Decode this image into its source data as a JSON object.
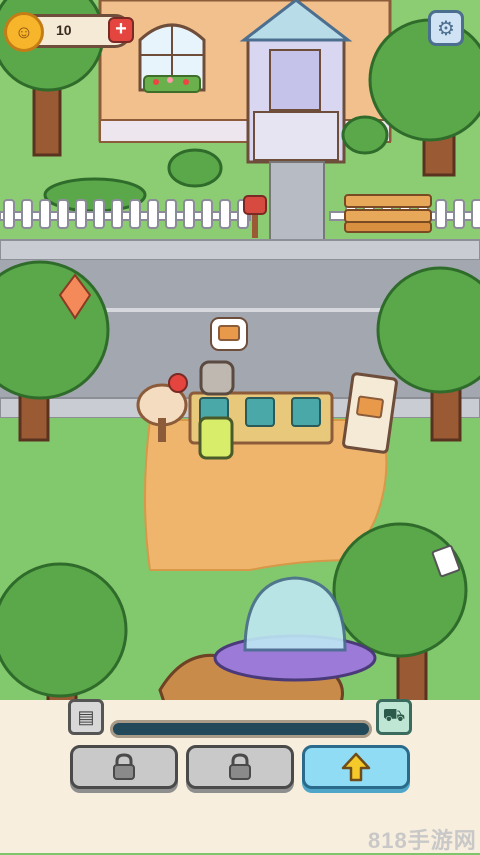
{
  "hud": {
    "coins": "10",
    "coin_icon": "smiley-coin-icon",
    "plus_icon": "plus-icon",
    "settings_icon": "gear-icon"
  },
  "scene": {
    "stand_item_icons": [
      "wrench-icon",
      "wrench-icon",
      "wrench-icon"
    ],
    "speech_bubble_icon": "sandwich-icon",
    "sign_icon": "sandwich-icon",
    "upgrade_badge_icon": "up-arrow-icon"
  },
  "bottom_bar": {
    "shop_icon": "shop-icon",
    "truck_icon": "food-truck-icon",
    "progress": 0,
    "buttons": [
      {
        "icon": "lock-icon",
        "locked": true
      },
      {
        "icon": "lock-icon",
        "locked": true
      },
      {
        "icon": "up-arrow-icon",
        "locked": false
      }
    ]
  },
  "watermark": "818手游网"
}
